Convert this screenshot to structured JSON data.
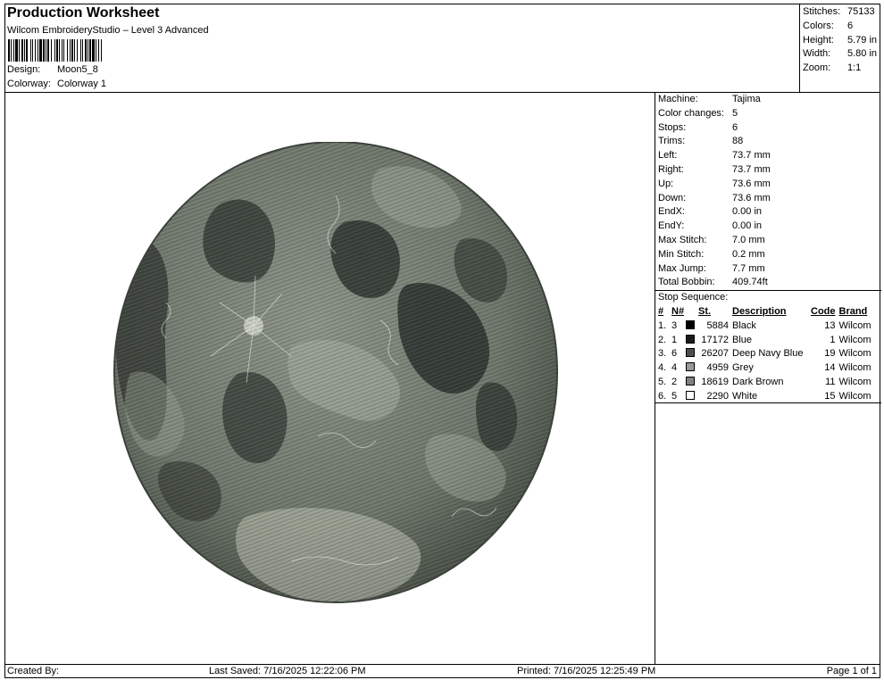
{
  "header": {
    "title": "Production Worksheet",
    "subtitle": "Wilcom EmbroideryStudio – Level 3 Advanced",
    "design_label": "Design:",
    "design_value": "Moon5_8",
    "colorway_label": "Colorway:",
    "colorway_value": "Colorway 1"
  },
  "stats": [
    {
      "label": "Stitches:",
      "value": "75133"
    },
    {
      "label": "Colors:",
      "value": "6"
    },
    {
      "label": "Height:",
      "value": "5.79 in"
    },
    {
      "label": "Width:",
      "value": "5.80 in"
    },
    {
      "label": "Zoom:",
      "value": "1:1"
    }
  ],
  "info": [
    {
      "label": "Machine:",
      "value": "Tajima"
    },
    {
      "label": "Color changes:",
      "value": "5"
    },
    {
      "label": "Stops:",
      "value": "6"
    },
    {
      "label": "Trims:",
      "value": "88"
    },
    {
      "label": "Left:",
      "value": "73.7 mm"
    },
    {
      "label": "Right:",
      "value": "73.7 mm"
    },
    {
      "label": "Up:",
      "value": "73.6 mm"
    },
    {
      "label": "Down:",
      "value": "73.6 mm"
    },
    {
      "label": "EndX:",
      "value": "0.00 in"
    },
    {
      "label": "EndY:",
      "value": "0.00 in"
    },
    {
      "label": "Max Stitch:",
      "value": "7.0 mm"
    },
    {
      "label": "Min Stitch:",
      "value": "0.2 mm"
    },
    {
      "label": "Max Jump:",
      "value": "7.7 mm"
    },
    {
      "label": "Total Bobbin:",
      "value": "409.74ft"
    }
  ],
  "stop_sequence": {
    "title": "Stop Sequence:",
    "columns": {
      "num": "#",
      "n": "N#",
      "st": "St.",
      "desc": "Description",
      "code": "Code",
      "brand": "Brand"
    },
    "rows": [
      {
        "num": "1.",
        "n": "3",
        "color": "#000000",
        "st": "5884",
        "desc": "Black",
        "code": "13",
        "brand": "Wilcom"
      },
      {
        "num": "2.",
        "n": "1",
        "color": "#1a1a1a",
        "st": "17172",
        "desc": "Blue",
        "code": "1",
        "brand": "Wilcom"
      },
      {
        "num": "3.",
        "n": "6",
        "color": "#4d4d4d",
        "st": "26207",
        "desc": "Deep Navy Blue",
        "code": "19",
        "brand": "Wilcom"
      },
      {
        "num": "4.",
        "n": "4",
        "color": "#999999",
        "st": "4959",
        "desc": "Grey",
        "code": "14",
        "brand": "Wilcom"
      },
      {
        "num": "5.",
        "n": "2",
        "color": "#808080",
        "st": "18619",
        "desc": "Dark Brown",
        "code": "11",
        "brand": "Wilcom"
      },
      {
        "num": "6.",
        "n": "5",
        "color": "#ffffff",
        "st": "2290",
        "desc": "White",
        "code": "15",
        "brand": "Wilcom"
      }
    ]
  },
  "footer": {
    "created_by": "Created By:",
    "last_saved": "Last Saved: 7/16/2025 12:22:06 PM",
    "printed": "Printed: 7/16/2025 12:25:49 PM",
    "page": "Page 1 of 1"
  }
}
